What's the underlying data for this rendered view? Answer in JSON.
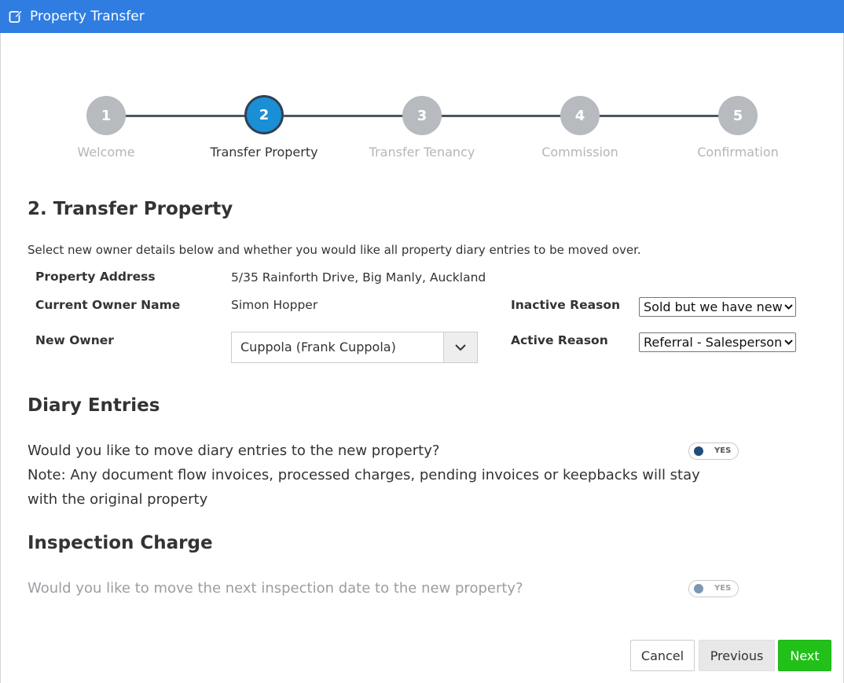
{
  "window": {
    "title": "Property Transfer",
    "title_icon": "edit-icon"
  },
  "stepper": {
    "steps": [
      {
        "number": "1",
        "label": "Welcome"
      },
      {
        "number": "2",
        "label": "Transfer Property"
      },
      {
        "number": "3",
        "label": "Transfer Tenancy"
      },
      {
        "number": "4",
        "label": "Commission"
      },
      {
        "number": "5",
        "label": "Confirmation"
      }
    ],
    "active_color": "#1b8fd6",
    "inactive_color": "#b7babe"
  },
  "section": {
    "title": "2. Transfer Property",
    "description": "Select new owner details below and whether you would like all property diary entries to be moved over."
  },
  "form": {
    "property_address_label": "Property Address",
    "property_address_value": "5/35 Rainforth Drive, Big Manly, Auckland",
    "current_owner_label": "Current Owner Name",
    "current_owner_value": "Simon Hopper",
    "new_owner_label": "New Owner",
    "new_owner_value": "Cuppola (Frank Cuppola)",
    "inactive_reason_label": "Inactive Reason",
    "inactive_reason_value": "Sold but we have new o",
    "active_reason_label": "Active Reason",
    "active_reason_value": "Referral - Salesperson"
  },
  "diary": {
    "title": "Diary Entries",
    "question": "Would you like to move diary entries to the new property?",
    "note_line1": "Note: Any document flow invoices, processed charges, pending invoices or keepbacks will stay",
    "note_line2": "with the original property",
    "toggle_label": "YES"
  },
  "inspection": {
    "title": "Inspection Charge",
    "question": "Would you like to move the next inspection date to the new property?",
    "toggle_label": "YES"
  },
  "buttons": {
    "cancel": "Cancel",
    "previous": "Previous",
    "next": "Next"
  },
  "colors": {
    "header": "#2f7de1",
    "next_button": "#22c11a"
  }
}
